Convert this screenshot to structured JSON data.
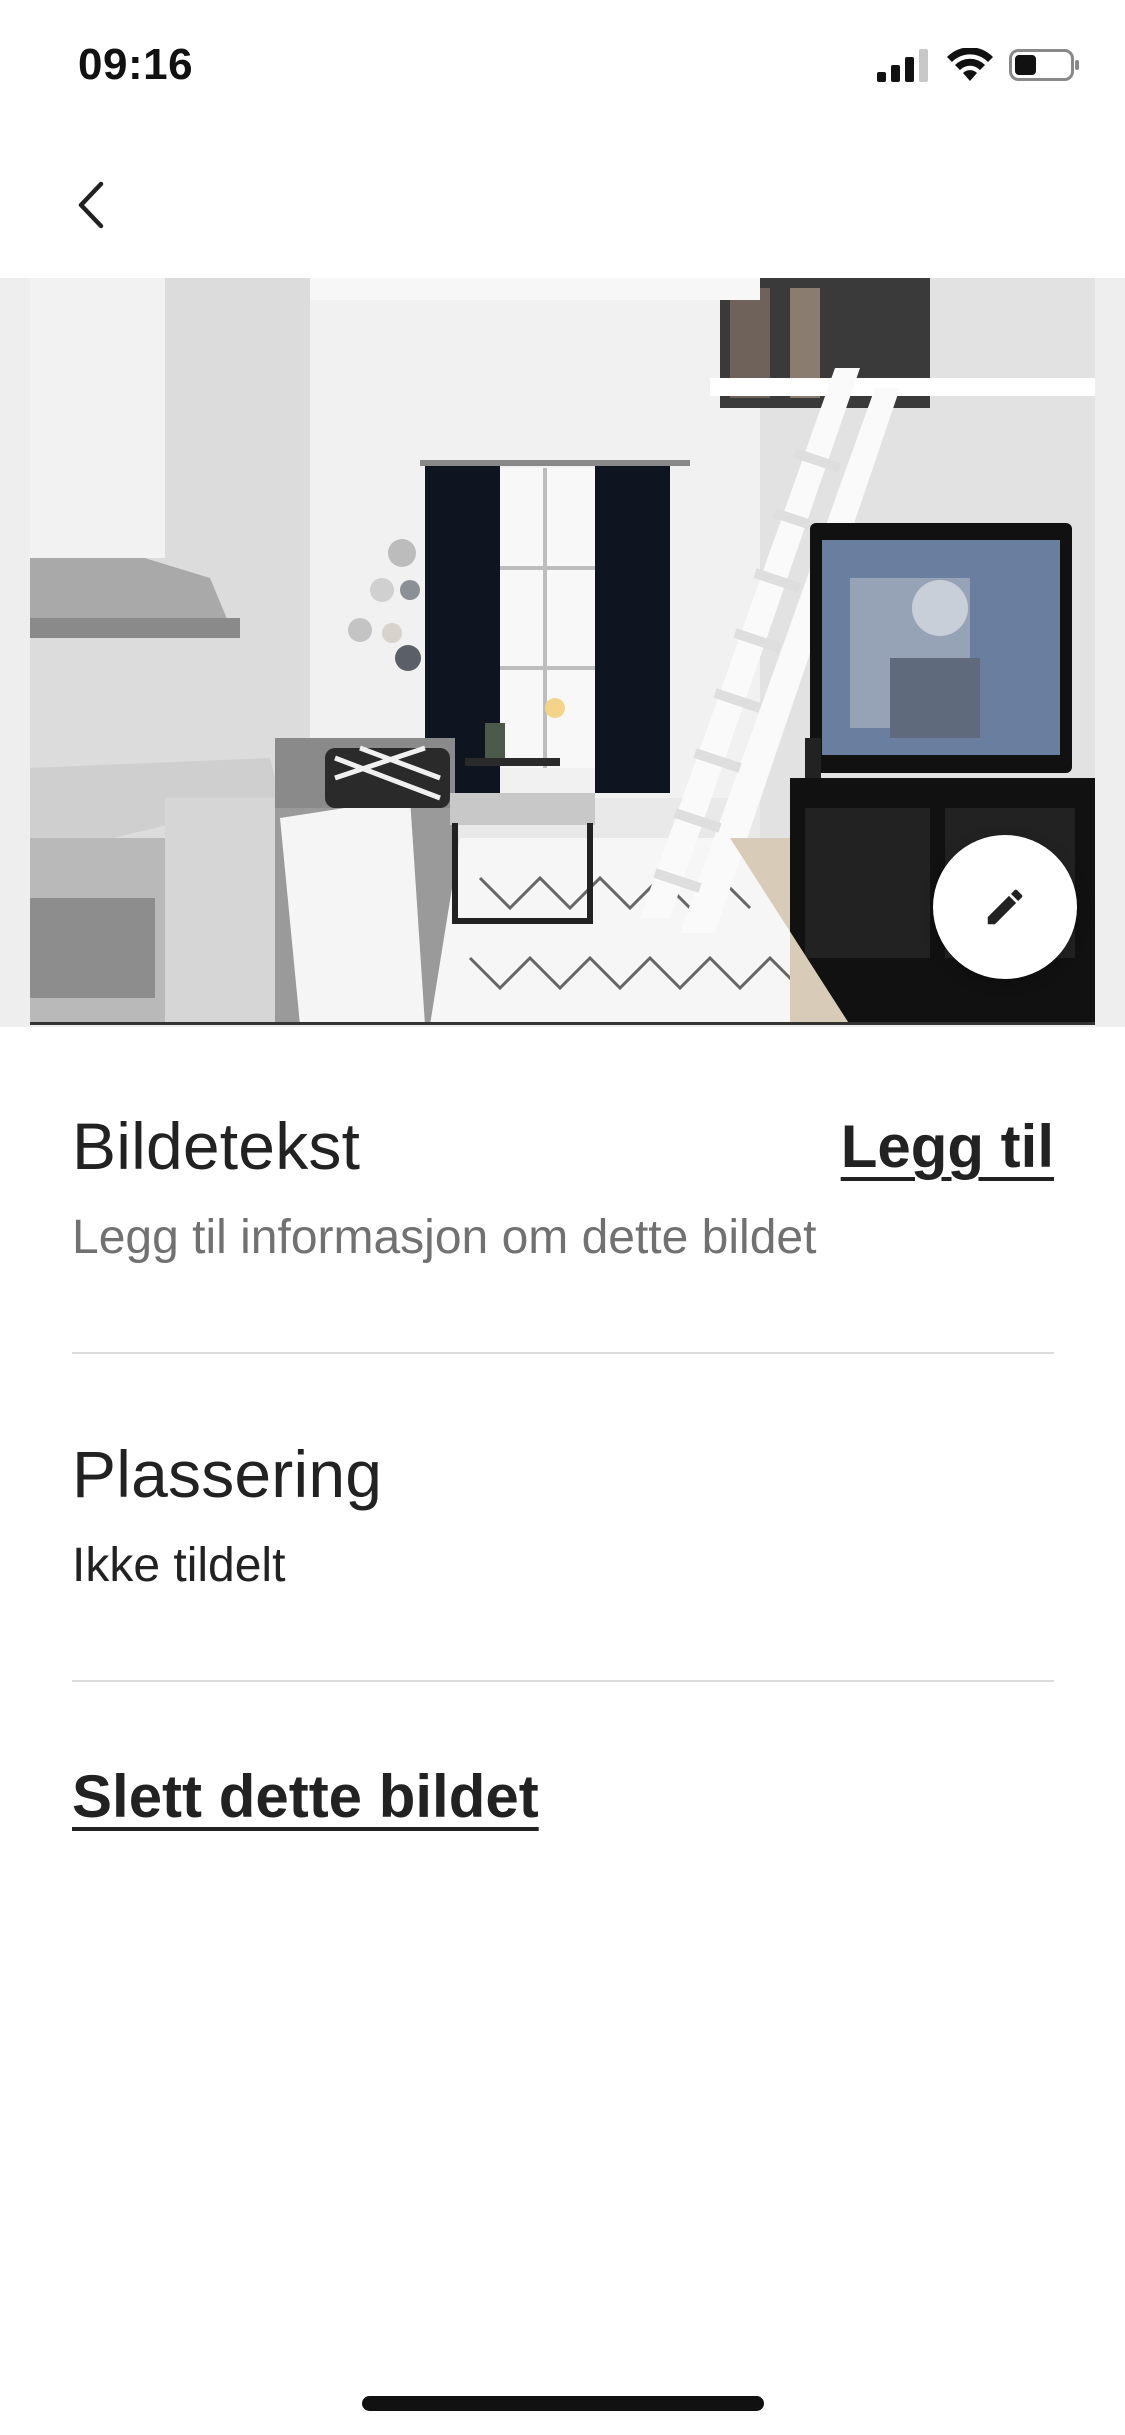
{
  "status_bar": {
    "time": "09:16",
    "battery_level": 0.4
  },
  "photo": {
    "alt": ""
  },
  "caption": {
    "title": "Bildetekst",
    "add_label": "Legg til",
    "placeholder": "Legg til informasjon om dette bildet"
  },
  "location": {
    "title": "Plassering",
    "value": "Ikke tildelt"
  },
  "actions": {
    "delete_label": "Slett dette bildet"
  },
  "icons": {
    "back": "chevron-left-icon",
    "edit": "pencil-icon"
  }
}
